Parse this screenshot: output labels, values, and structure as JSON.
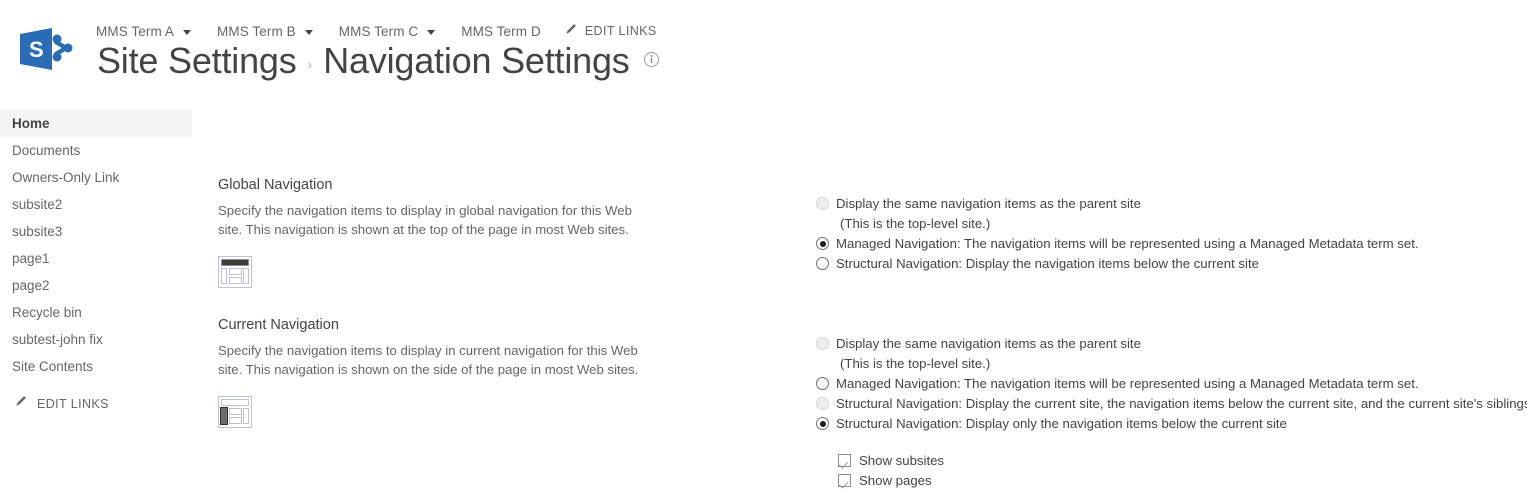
{
  "suite": {
    "logo_letter": "S",
    "top_nav": [
      {
        "label": "MMS Term A",
        "has_caret": true
      },
      {
        "label": "MMS Term B",
        "has_caret": true
      },
      {
        "label": "MMS Term C",
        "has_caret": true
      },
      {
        "label": "MMS Term D",
        "has_caret": false
      }
    ],
    "edit_links_label": "EDIT LINKS",
    "edit_links_icon": "pencil-icon"
  },
  "header": {
    "breadcrumb_parent": "Site Settings",
    "breadcrumb_separator": "›",
    "page_title": "Navigation Settings",
    "info_icon": "info-circle-icon"
  },
  "quick_launch": {
    "items": [
      {
        "label": "Home",
        "selected": true
      },
      {
        "label": "Documents",
        "selected": false
      },
      {
        "label": "Owners-Only Link",
        "selected": false
      },
      {
        "label": "subsite2",
        "selected": false
      },
      {
        "label": "subsite3",
        "selected": false
      },
      {
        "label": "page1",
        "selected": false
      },
      {
        "label": "page2",
        "selected": false
      },
      {
        "label": "Recycle bin",
        "selected": false
      },
      {
        "label": "subtest-john fix",
        "selected": false
      },
      {
        "label": "Site Contents",
        "selected": false
      }
    ],
    "edit_links_label": "EDIT LINKS",
    "edit_links_icon": "pencil-icon"
  },
  "global_navigation": {
    "title": "Global Navigation",
    "description": "Specify the navigation items to display in global navigation for this Web site. This navigation is shown at the top of the page in most Web sites.",
    "layout_icon": "page-layout-top-bar-icon",
    "options": [
      {
        "label": "Display the same navigation items as the parent site",
        "selected": false,
        "disabled": true
      },
      {
        "label": "Managed Navigation: The navigation items will be represented using a Managed Metadata term set.",
        "selected": true,
        "disabled": false
      },
      {
        "label": "Structural Navigation: Display the navigation items below the current site",
        "selected": false,
        "disabled": false
      }
    ],
    "parent_note": "(This is the top-level site.)"
  },
  "current_navigation": {
    "title": "Current Navigation",
    "description": "Specify the navigation items to display in current navigation for this Web site. This navigation is shown on the side of the page in most Web sites.",
    "layout_icon": "page-layout-left-bar-icon",
    "options": [
      {
        "label": "Display the same navigation items as the parent site",
        "selected": false,
        "disabled": true
      },
      {
        "label": "Managed Navigation: The navigation items will be represented using a Managed Metadata term set.",
        "selected": false,
        "disabled": false
      },
      {
        "label": "Structural Navigation: Display the current site, the navigation items below the current site, and the current site's siblings",
        "selected": false,
        "disabled": true
      },
      {
        "label": "Structural Navigation: Display only the navigation items below the current site",
        "selected": true,
        "disabled": false
      }
    ],
    "parent_note": "(This is the top-level site.)",
    "checkboxes": [
      {
        "label": "Show subsites",
        "checked": true
      },
      {
        "label": "Show pages",
        "checked": true
      }
    ]
  },
  "colors": {
    "brand_blue": "#2a6cb5",
    "text_dark": "#444444",
    "text_muted": "#666666",
    "selection_bg": "#f4f4f4",
    "icon_outline": "#b9c2d8"
  }
}
